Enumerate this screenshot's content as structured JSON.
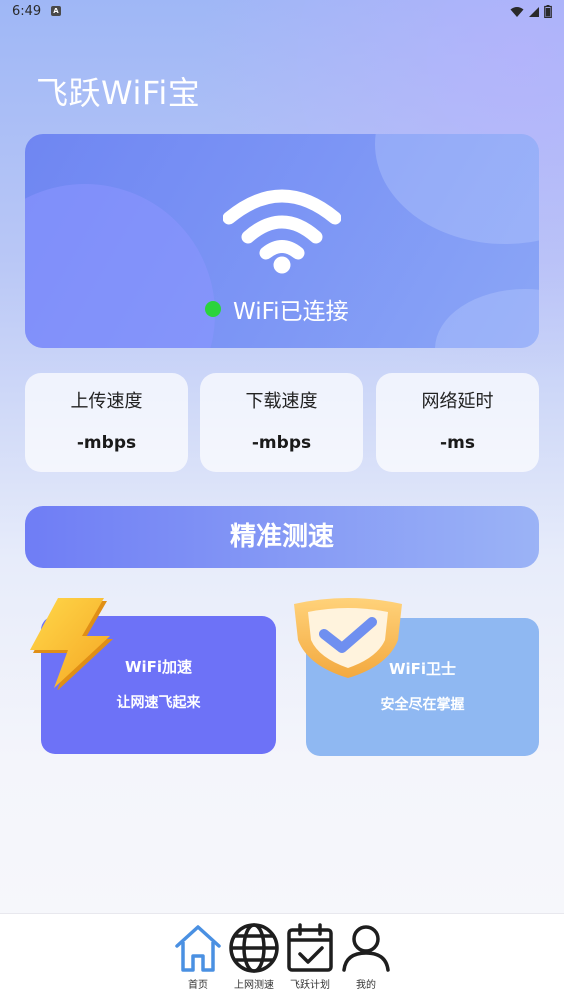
{
  "status_bar": {
    "time": "6:49",
    "notification_icon": "A"
  },
  "app": {
    "title": "飞跃WiFi宝"
  },
  "hero": {
    "status_text": "WiFi已连接",
    "status_color": "#2bd33c"
  },
  "stats": [
    {
      "label": "上传速度",
      "value": "-mbps"
    },
    {
      "label": "下载速度",
      "value": "-mbps"
    },
    {
      "label": "网络延时",
      "value": "-ms"
    }
  ],
  "measure_button": {
    "label": "精准测速"
  },
  "features": {
    "accelerate": {
      "title": "WiFi加速",
      "subtitle": "让网速飞起来",
      "icon": "lightning-bolt-icon"
    },
    "guard": {
      "title": "WiFi卫士",
      "subtitle": "安全尽在掌握",
      "icon": "shield-check-icon"
    }
  },
  "nav": {
    "items": [
      {
        "label": "首页",
        "icon": "home-icon",
        "active": true
      },
      {
        "label": "上网测速",
        "icon": "globe-icon"
      },
      {
        "label": "飞跃计划",
        "icon": "calendar-check-icon"
      },
      {
        "label": "我的",
        "icon": "user-icon"
      }
    ],
    "accent_color": "#4a90e2"
  }
}
